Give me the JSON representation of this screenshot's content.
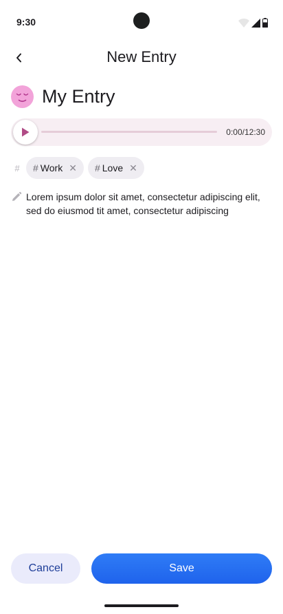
{
  "status_bar": {
    "time": "9:30",
    "icons": [
      "wifi-icon",
      "signal-icon",
      "battery-icon"
    ]
  },
  "app_bar": {
    "back_icon": "chevron-left-icon",
    "title": "New Entry"
  },
  "entry": {
    "mood_icon": "relieved-face-icon",
    "mood_color": "#f2a3d9",
    "title": "My Entry"
  },
  "audio": {
    "play_icon": "play-icon",
    "accent_color": "#b04b86",
    "progress": 0,
    "time_display": "0:00/12:30"
  },
  "tags": {
    "icon": "hash-icon",
    "hash_symbol": "#",
    "items": [
      {
        "label": "Work",
        "remove_icon": "close-icon",
        "remove_glyph": "✕"
      },
      {
        "label": "Love",
        "remove_icon": "close-icon",
        "remove_glyph": "✕"
      }
    ]
  },
  "note": {
    "icon": "pencil-icon",
    "text": "Lorem ipsum dolor sit amet, consectetur adipiscing elit, sed do eiusmod tit amet, consectetur adipiscing"
  },
  "actions": {
    "cancel_label": "Cancel",
    "save_label": "Save"
  }
}
